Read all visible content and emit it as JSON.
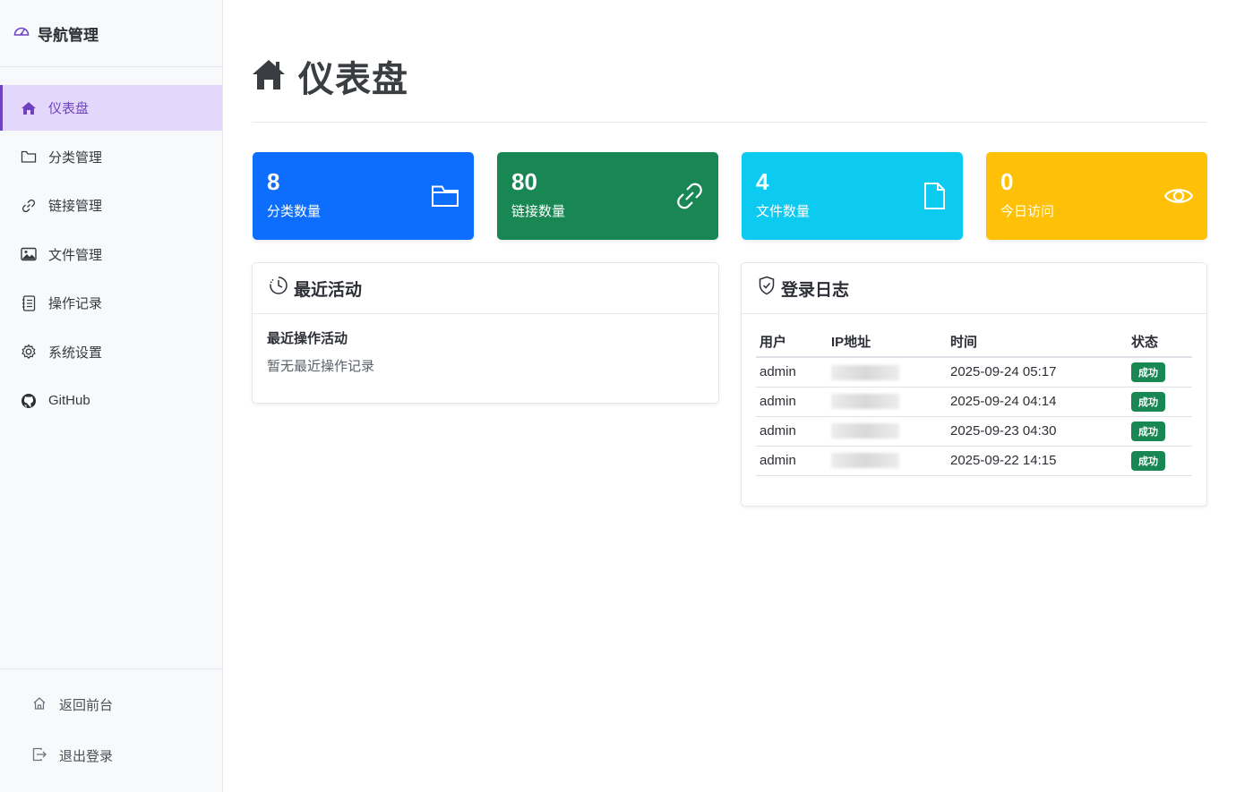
{
  "sidebar": {
    "brand": "导航管理",
    "items": [
      {
        "label": "仪表盘",
        "icon": "house-icon"
      },
      {
        "label": "分类管理",
        "icon": "folder-icon"
      },
      {
        "label": "链接管理",
        "icon": "link-icon"
      },
      {
        "label": "文件管理",
        "icon": "image-icon"
      },
      {
        "label": "操作记录",
        "icon": "journal-icon"
      },
      {
        "label": "系统设置",
        "icon": "gear-icon"
      },
      {
        "label": "GitHub",
        "icon": "github-icon"
      }
    ],
    "bottom": [
      {
        "label": "返回前台",
        "icon": "house-outline-icon"
      },
      {
        "label": "退出登录",
        "icon": "logout-icon"
      }
    ]
  },
  "page": {
    "title": "仪表盘"
  },
  "cards": [
    {
      "value": "8",
      "label": "分类数量",
      "color": "#0d6efd",
      "icon": "folder-icon"
    },
    {
      "value": "80",
      "label": "链接数量",
      "color": "#198754",
      "icon": "link-icon"
    },
    {
      "value": "4",
      "label": "文件数量",
      "color": "#0dcaf0",
      "icon": "file-icon"
    },
    {
      "value": "0",
      "label": "今日访问",
      "color": "#ffc107",
      "icon": "eye-icon"
    }
  ],
  "recent": {
    "title": "最近活动",
    "subtitle": "最近操作活动",
    "empty": "暂无最近操作记录"
  },
  "login_log": {
    "title": "登录日志",
    "columns": [
      "用户",
      "IP地址",
      "时间",
      "状态"
    ],
    "rows": [
      {
        "user": "admin",
        "time": "2025-09-24 05:17",
        "status": "成功"
      },
      {
        "user": "admin",
        "time": "2025-09-24 04:14",
        "status": "成功"
      },
      {
        "user": "admin",
        "time": "2025-09-23 04:30",
        "status": "成功"
      },
      {
        "user": "admin",
        "time": "2025-09-22 14:15",
        "status": "成功"
      }
    ]
  },
  "colors": {
    "accent": "#6f42c1",
    "success": "#198754"
  }
}
